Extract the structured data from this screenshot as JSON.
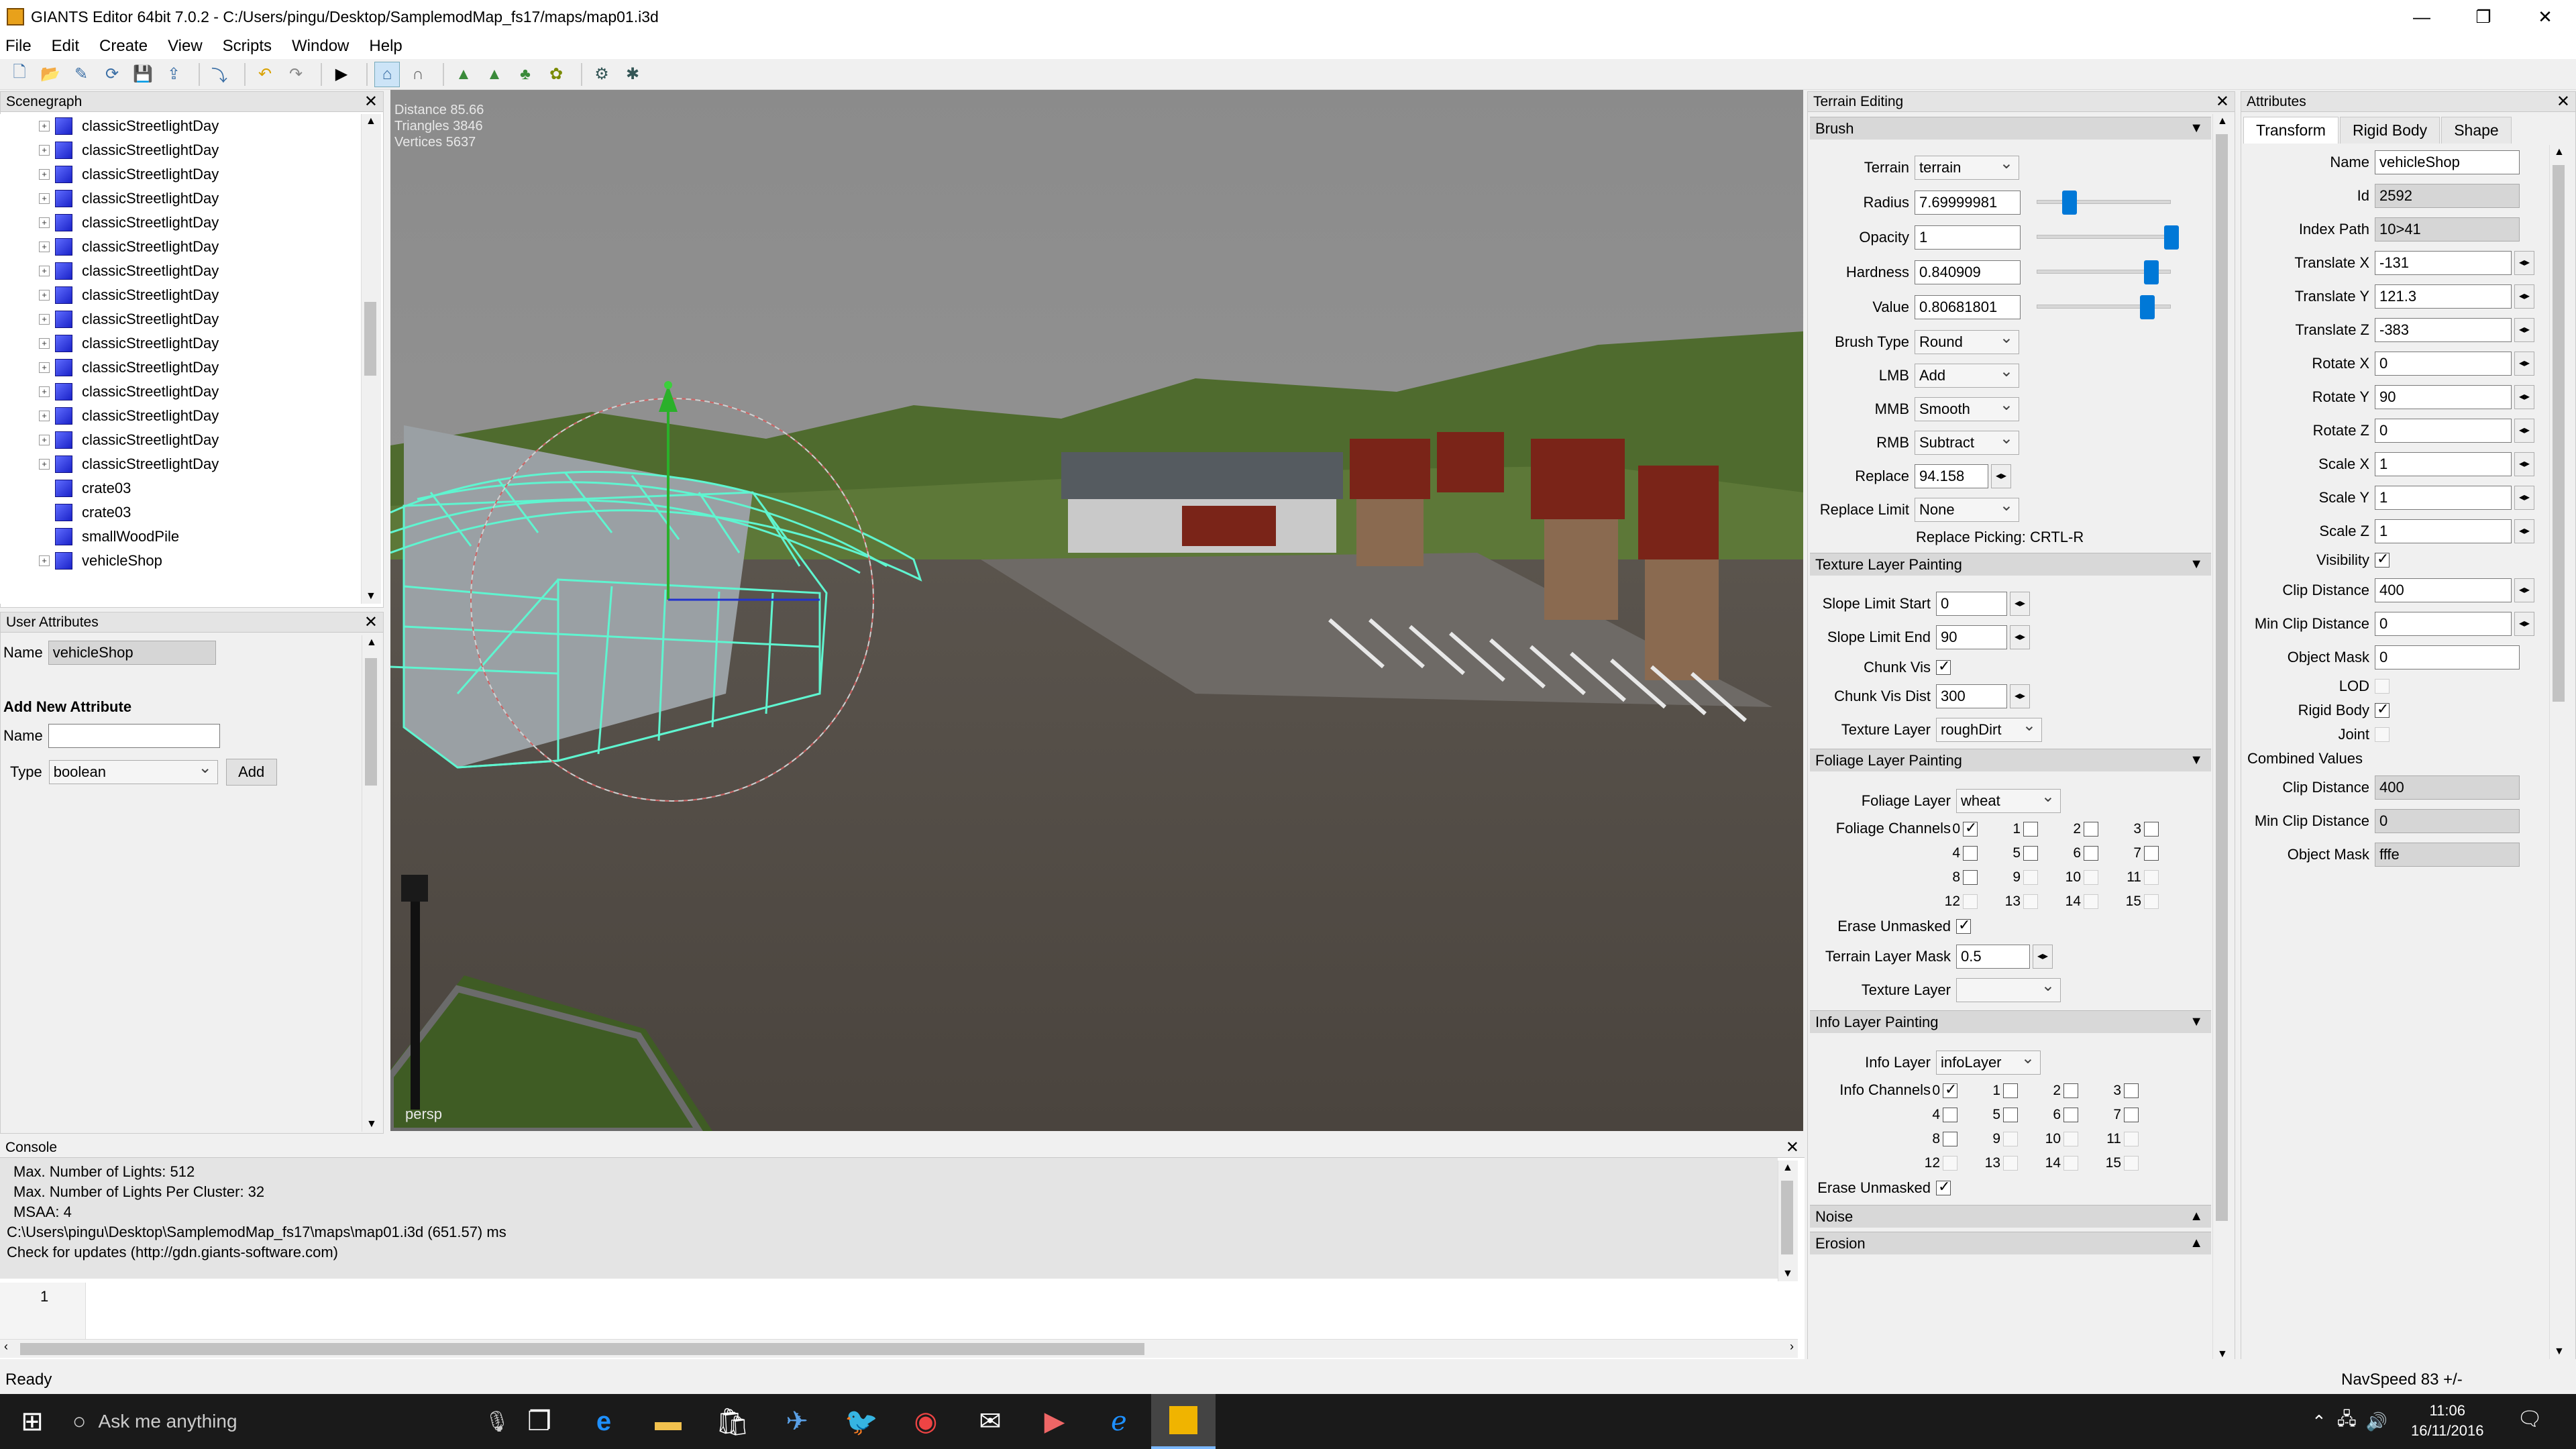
{
  "window": {
    "title": "GIANTS Editor 64bit 7.0.2 - C:/Users/pingu/Desktop/SamplemodMap_fs17/maps/map01.i3d",
    "minimize": "—",
    "maximize": "❐",
    "close": "✕"
  },
  "menu": [
    "File",
    "Edit",
    "Create",
    "View",
    "Scripts",
    "Window",
    "Help"
  ],
  "scenegraph": {
    "title": "Scenegraph",
    "items": [
      {
        "label": "classicStreetlightDay",
        "expandable": true
      },
      {
        "label": "classicStreetlightDay",
        "expandable": true
      },
      {
        "label": "classicStreetlightDay",
        "expandable": true
      },
      {
        "label": "classicStreetlightDay",
        "expandable": true
      },
      {
        "label": "classicStreetlightDay",
        "expandable": true
      },
      {
        "label": "classicStreetlightDay",
        "expandable": true
      },
      {
        "label": "classicStreetlightDay",
        "expandable": true
      },
      {
        "label": "classicStreetlightDay",
        "expandable": true
      },
      {
        "label": "classicStreetlightDay",
        "expandable": true
      },
      {
        "label": "classicStreetlightDay",
        "expandable": true
      },
      {
        "label": "classicStreetlightDay",
        "expandable": true
      },
      {
        "label": "classicStreetlightDay",
        "expandable": true
      },
      {
        "label": "classicStreetlightDay",
        "expandable": true
      },
      {
        "label": "classicStreetlightDay",
        "expandable": true
      },
      {
        "label": "classicStreetlightDay",
        "expandable": true
      },
      {
        "label": "crate03",
        "expandable": false
      },
      {
        "label": "crate03",
        "expandable": false
      },
      {
        "label": "smallWoodPile",
        "expandable": false
      },
      {
        "label": "vehicleShop",
        "expandable": true
      }
    ]
  },
  "user_attributes": {
    "title": "User Attributes",
    "name_label": "Name",
    "name_value": "vehicleShop",
    "add_title": "Add New Attribute",
    "new_name_label": "Name",
    "type_label": "Type",
    "type_value": "boolean",
    "add_button": "Add"
  },
  "viewport": {
    "distance": "Distance 85.66",
    "triangles": "Triangles 3846",
    "vertices": "Vertices 5637",
    "camera": "persp"
  },
  "console": {
    "title": "Console",
    "lines": [
      "Max. Number of Lights: 512",
      "Max. Number of Lights Per Cluster: 32",
      "MSAA: 4",
      "C:\\Users\\pingu\\Desktop\\SamplemodMap_fs17\\maps\\map01.i3d (651.57) ms",
      "Check for updates (http://gdn.giants-software.com)"
    ],
    "line_number": "1"
  },
  "terrain": {
    "title": "Terrain Editing",
    "brush": {
      "title": "Brush",
      "terrain_label": "Terrain",
      "terrain": "terrain",
      "radius_label": "Radius",
      "radius": "7.69999981",
      "opacity_label": "Opacity",
      "opacity": "1",
      "hardness_label": "Hardness",
      "hardness": "0.840909",
      "value_label": "Value",
      "value": "0.80681801",
      "brush_type_label": "Brush Type",
      "brush_type": "Round",
      "lmb_label": "LMB",
      "lmb": "Add",
      "mmb_label": "MMB",
      "mmb": "Smooth",
      "rmb_label": "RMB",
      "rmb": "Subtract",
      "replace_label": "Replace",
      "replace": "94.158",
      "replace_limit_label": "Replace Limit",
      "replace_limit": "None",
      "replace_picking": "Replace Picking: CRTL-R",
      "slider_levels": {
        "radius": 0.2,
        "opacity": 1.0,
        "hardness": 0.84,
        "value": 0.81
      }
    },
    "texture": {
      "title": "Texture Layer Painting",
      "slope_start_label": "Slope Limit Start",
      "slope_start": "0",
      "slope_end_label": "Slope Limit End",
      "slope_end": "90",
      "chunk_vis_label": "Chunk Vis",
      "chunk_vis_dist_label": "Chunk Vis Dist",
      "chunk_vis_dist": "300",
      "texture_layer_label": "Texture Layer",
      "texture_layer": "roughDirt"
    },
    "foliage": {
      "title": "Foliage Layer Painting",
      "layer_label": "Foliage Layer",
      "layer": "wheat",
      "channels_label": "Foliage Channels",
      "erase_label": "Erase Unmasked",
      "mask_label": "Terrain Layer Mask",
      "mask": "0.5",
      "texture_layer_label": "Texture Layer"
    },
    "info": {
      "title": "Info Layer Painting",
      "layer_label": "Info Layer",
      "layer": "infoLayer",
      "channels_label": "Info Channels",
      "erase_label": "Erase Unmasked"
    },
    "noise": "Noise",
    "erosion": "Erosion"
  },
  "attributes": {
    "title": "Attributes",
    "tabs": [
      "Transform",
      "Rigid Body",
      "Shape"
    ],
    "name_label": "Name",
    "name": "vehicleShop",
    "id_label": "Id",
    "id": "2592",
    "index_path_label": "Index Path",
    "index_path": "10>41",
    "tx_label": "Translate X",
    "tx": "-131",
    "ty_label": "Translate Y",
    "ty": "121.3",
    "tz_label": "Translate Z",
    "tz": "-383",
    "rx_label": "Rotate X",
    "rx": "0",
    "ry_label": "Rotate Y",
    "ry": "90",
    "rz_label": "Rotate Z",
    "rz": "0",
    "sx_label": "Scale X",
    "sx": "1",
    "sy_label": "Scale Y",
    "sy": "1",
    "sz_label": "Scale Z",
    "sz": "1",
    "visibility_label": "Visibility",
    "clip_label": "Clip Distance",
    "clip": "400",
    "min_clip_label": "Min Clip Distance",
    "min_clip": "0",
    "mask_label": "Object Mask",
    "mask": "0",
    "lod_label": "LOD",
    "rigid_label": "Rigid Body",
    "joint_label": "Joint",
    "combined_label": "Combined Values",
    "c_clip_label": "Clip Distance",
    "c_clip": "400",
    "c_min_clip_label": "Min Clip Distance",
    "c_min_clip": "0",
    "c_mask_label": "Object Mask",
    "c_mask": "fffe"
  },
  "status": {
    "left": "Ready",
    "right": "NavSpeed 83 +/-"
  },
  "taskbar": {
    "search": "Ask me anything",
    "time": "11:06",
    "date": "16/11/2016"
  },
  "colors": {
    "accent": "#0078d7",
    "gizmo": "#5ff5d0",
    "taskbar": "#1a1a1a"
  }
}
